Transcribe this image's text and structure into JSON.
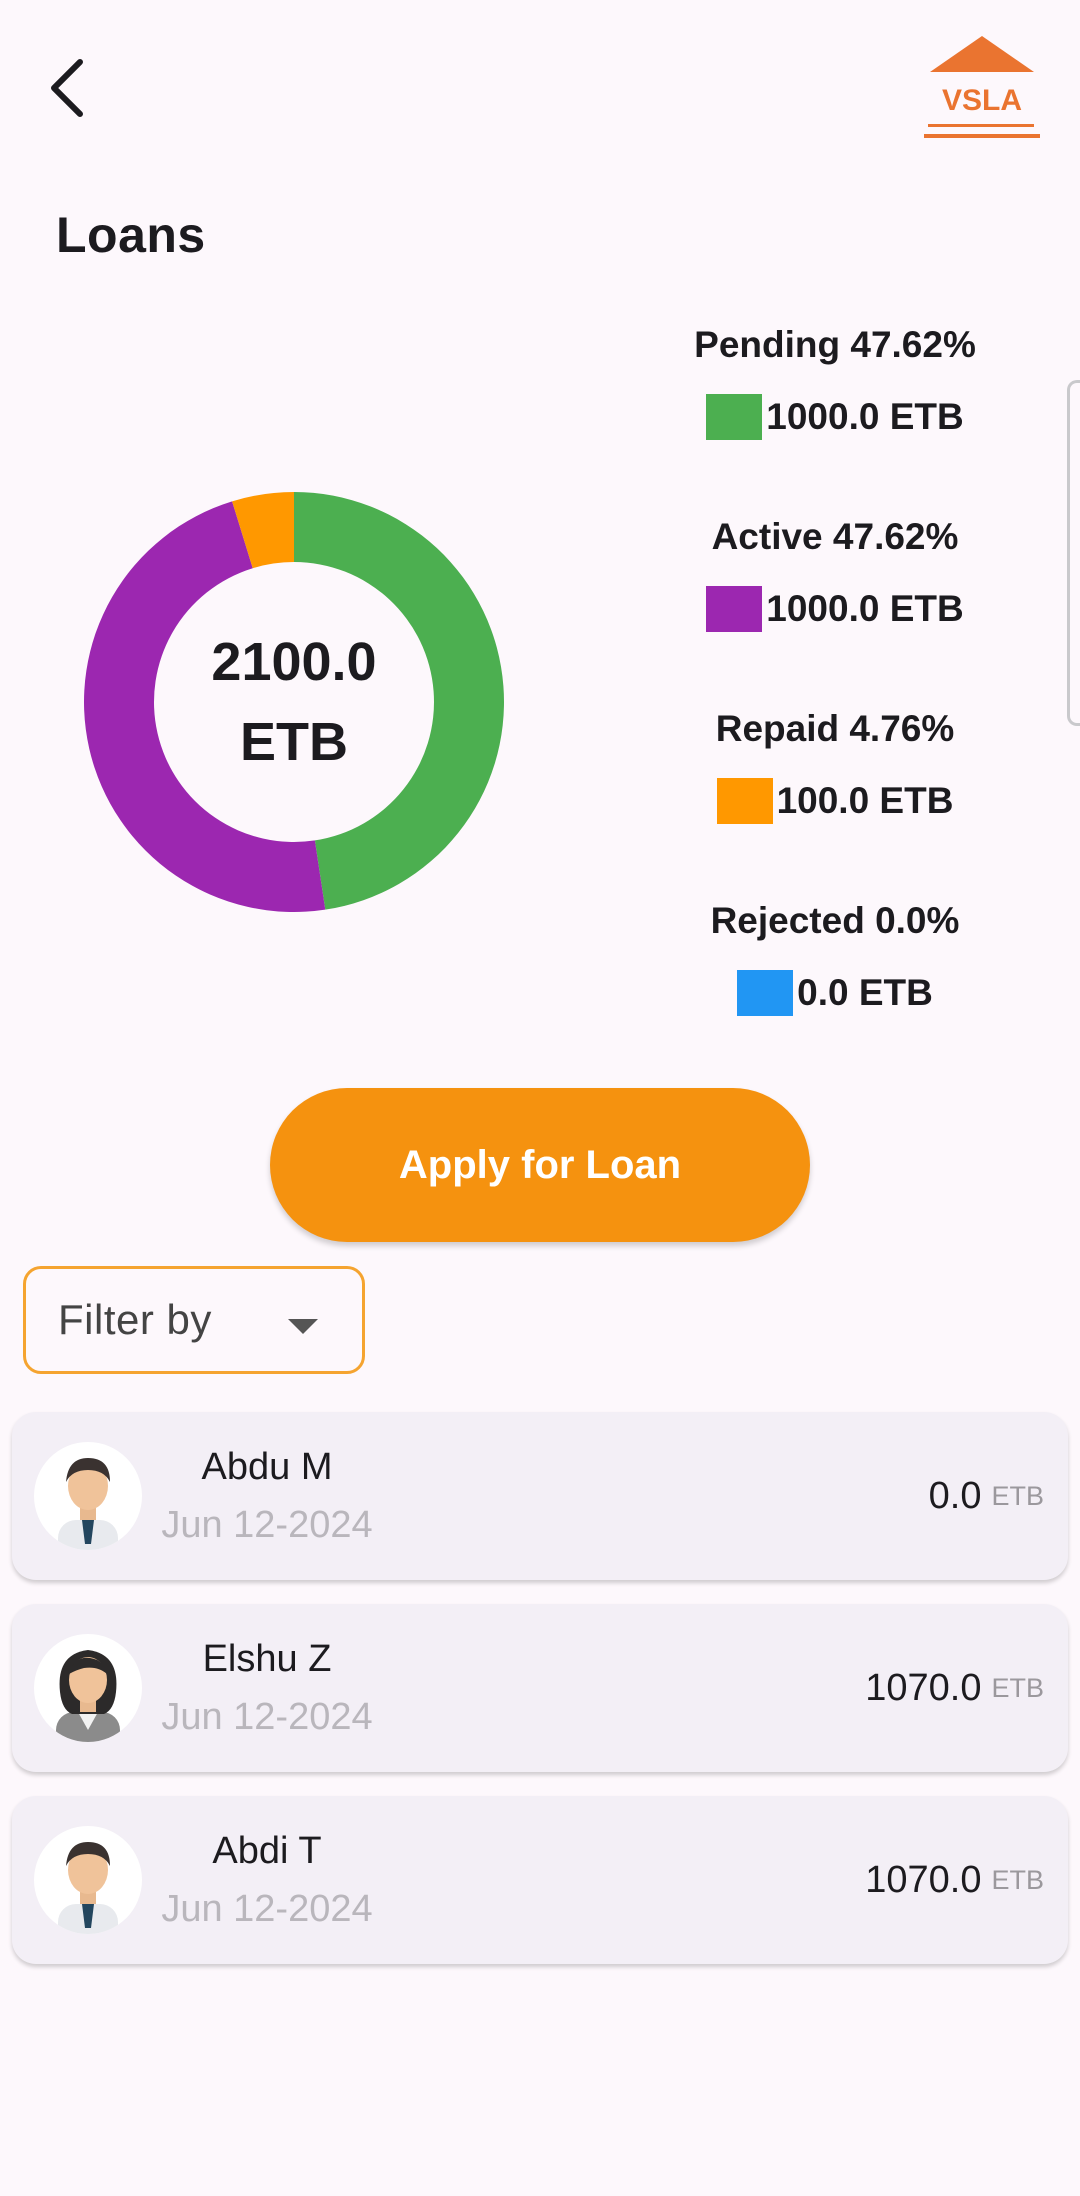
{
  "header": {
    "back_icon": "chevron-left-icon",
    "logo_text": "VSLA"
  },
  "page_title": "Loans",
  "chart_data": {
    "type": "pie",
    "center_text": [
      "2100.0",
      "ETB"
    ],
    "slices": [
      {
        "name": "Pending",
        "value": 1000.0,
        "color": "#4caf50"
      },
      {
        "name": "Active",
        "value": 1000.0,
        "color": "#9c27b0"
      },
      {
        "name": "Repaid",
        "value": 100.0,
        "color": "#ff9800"
      },
      {
        "name": "Rejected",
        "value": 0.0,
        "color": "#2196f3"
      }
    ]
  },
  "legend": [
    {
      "label": "Pending 47.62%",
      "value": "1000.0 ETB",
      "color": "#4caf50"
    },
    {
      "label": "Active 47.62%",
      "value": "1000.0 ETB",
      "color": "#9c27b0"
    },
    {
      "label": "Repaid 4.76%",
      "value": "100.0 ETB",
      "color": "#ff9800"
    },
    {
      "label": "Rejected 0.0%",
      "value": "0.0 ETB",
      "color": "#2196f3"
    }
  ],
  "apply_button": "Apply for Loan",
  "filter": {
    "label": "Filter by",
    "icon": "caret-down-icon"
  },
  "loans": [
    {
      "name": "Abdu M",
      "date": "Jun 12-2024",
      "amount": "0.0",
      "currency": "ETB",
      "avatar": "male-avatar-icon"
    },
    {
      "name": "Elshu Z",
      "date": "Jun 12-2024",
      "amount": "1070.0",
      "currency": "ETB",
      "avatar": "female-avatar-icon"
    },
    {
      "name": "Abdi T",
      "date": "Jun 12-2024",
      "amount": "1070.0",
      "currency": "ETB",
      "avatar": "male-avatar-icon"
    }
  ],
  "colors": {
    "accent": "#f5920f",
    "background": "#fdf8fc",
    "card": "#f3eff6",
    "logo": "#ea7430"
  }
}
